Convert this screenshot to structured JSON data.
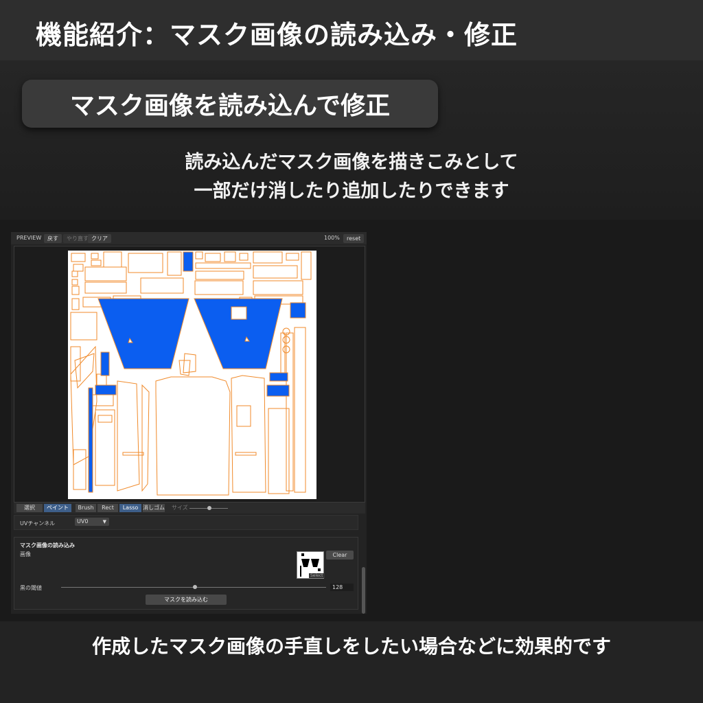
{
  "header": {
    "title": "機能紹介：マスク画像の読み込み・修正"
  },
  "hero": {
    "pill": "マスク画像を読み込んで修正",
    "desc_line1": "読み込んだマスク画像を描きこみとして",
    "desc_line2": "一部だけ消したり追加したりできます"
  },
  "footer": {
    "text": "作成したマスク画像の手直しをしたい場合などに効果的です"
  },
  "editor": {
    "preview_label": "PREVIEW",
    "undo": "戻す",
    "redo": "やり直す",
    "clear": "クリア",
    "zoom": "100%",
    "reset": "reset",
    "tools": {
      "select": "選択",
      "paint": "ペイント",
      "brush": "Brush",
      "rect": "Rect",
      "lasso": "Lasso",
      "eraser": "消しゴム",
      "size_label": "サイズ"
    },
    "uv_channel_label": "UVチャンネル",
    "uv_channel_value": "UV0",
    "mask_section": {
      "title": "マスク画像の読み込み",
      "image_label": "画像",
      "clear_button": "Clear",
      "select_label": "Select",
      "threshold_label": "黒の閾値",
      "threshold_value": "128",
      "load_button": "マスクを読み込む"
    }
  },
  "colors": {
    "mask_fill": "#0b5ef0",
    "uv_outline": "#f08a2a",
    "paint_active": "#3e5f8a"
  }
}
